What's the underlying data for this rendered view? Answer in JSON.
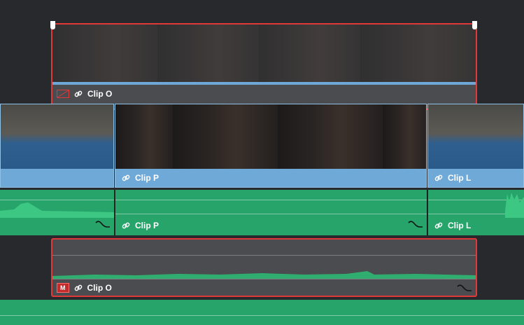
{
  "colors": {
    "background": "#28292c",
    "video_clip": "#6fa9d8",
    "video_clip_label_bar": "#6ea8d8",
    "audio_clip": "#27a46a",
    "selected_border": "#e0393a",
    "disabled_clip": "#4b4c4f"
  },
  "video_track_2": {
    "clip_o": {
      "name": "Clip O",
      "disabled_icon": "disabled-video-icon",
      "link_icon": "link-icon"
    }
  },
  "video_track_1": {
    "clips": [
      {
        "name": "",
        "thumb": "pool-table"
      },
      {
        "name": "Clip P",
        "link_icon": "link-icon",
        "thumb": "woman-portrait"
      },
      {
        "name": "Clip L",
        "link_icon": "link-icon",
        "thumb": "pool-table"
      }
    ]
  },
  "audio_track_1": {
    "clips": [
      {
        "name": "",
        "curve_icon": "fade-curve-icon"
      },
      {
        "name": "Clip P",
        "link_icon": "link-icon",
        "curve_icon": "fade-curve-icon"
      },
      {
        "name": "Clip L",
        "link_icon": "link-icon"
      }
    ]
  },
  "audio_track_2": {
    "clip_o": {
      "name": "Clip O",
      "mute_badge": "M",
      "link_icon": "link-icon",
      "curve_icon": "fade-curve-icon"
    }
  }
}
